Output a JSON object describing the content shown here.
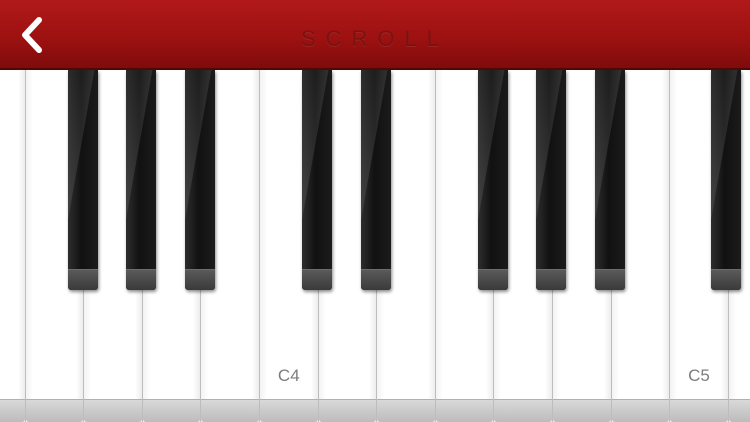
{
  "header": {
    "back_icon": "chevron-left-icon",
    "title": "SCROLL",
    "background_color": "#a31414"
  },
  "keyboard": {
    "white_keys": [
      {
        "name": "white-key-partial-left",
        "label": ""
      },
      {
        "name": "white-key-f3",
        "label": ""
      },
      {
        "name": "white-key-g3",
        "label": ""
      },
      {
        "name": "white-key-a3",
        "label": ""
      },
      {
        "name": "white-key-b3",
        "label": ""
      },
      {
        "name": "white-key-c4",
        "label": "C4"
      },
      {
        "name": "white-key-d4",
        "label": ""
      },
      {
        "name": "white-key-e4",
        "label": ""
      },
      {
        "name": "white-key-f4",
        "label": ""
      },
      {
        "name": "white-key-g4",
        "label": ""
      },
      {
        "name": "white-key-a4",
        "label": ""
      },
      {
        "name": "white-key-b4",
        "label": ""
      },
      {
        "name": "white-key-c5",
        "label": "C5"
      },
      {
        "name": "white-key-d5",
        "label": ""
      }
    ],
    "black_keys": [
      {
        "name": "black-key-fsharp3"
      },
      {
        "name": "black-key-gsharp3"
      },
      {
        "name": "black-key-asharp3"
      },
      {
        "name": "black-key-csharp4"
      },
      {
        "name": "black-key-dsharp4"
      },
      {
        "name": "black-key-fsharp4"
      },
      {
        "name": "black-key-gsharp4"
      },
      {
        "name": "black-key-asharp4"
      },
      {
        "name": "black-key-csharp5"
      }
    ]
  }
}
